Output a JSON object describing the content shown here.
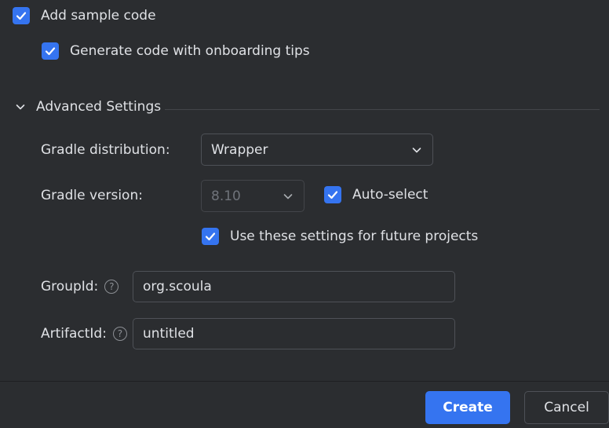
{
  "options": {
    "add_sample_code": {
      "label": "Add sample code",
      "checked": true
    },
    "onboarding_tips": {
      "label": "Generate code with onboarding tips",
      "checked": true
    }
  },
  "advanced": {
    "title": "Advanced Settings",
    "expanded": true,
    "gradle_distribution": {
      "label": "Gradle distribution:",
      "value": "Wrapper"
    },
    "gradle_version": {
      "label": "Gradle version:",
      "value": "8.10",
      "disabled": true
    },
    "auto_select": {
      "label": "Auto-select",
      "checked": true
    },
    "future_projects": {
      "label": "Use these settings for future projects",
      "checked": true
    },
    "group_id": {
      "label": "GroupId:",
      "value": "org.scoula"
    },
    "artifact_id": {
      "label": "ArtifactId:",
      "value": "untitled"
    }
  },
  "footer": {
    "create_label": "Create",
    "cancel_label": "Cancel"
  },
  "colors": {
    "background": "#2b2d30",
    "accent": "#3574f0",
    "text": "#dfe1e5",
    "disabled_text": "#6f737a",
    "border": "#4e5157"
  },
  "icons": {
    "checkbox": "check-icon",
    "section_toggle": "chevron-down-icon",
    "dropdown": "chevron-down-icon",
    "help": "help-icon"
  }
}
